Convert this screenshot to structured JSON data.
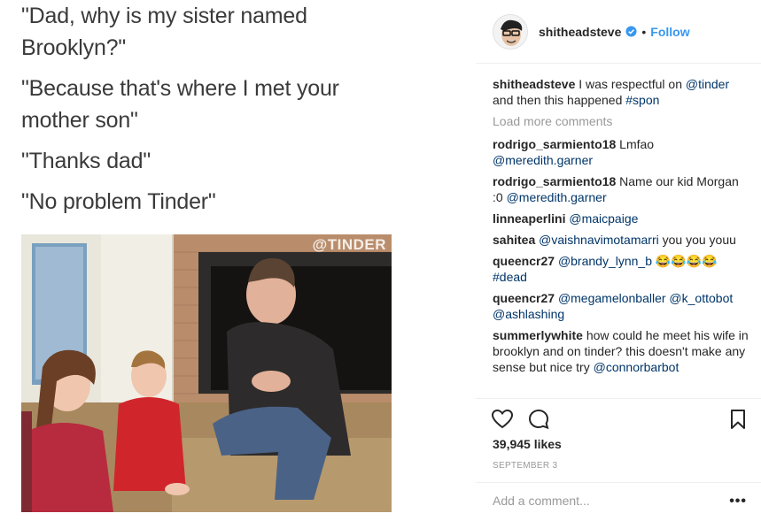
{
  "post": {
    "meme_lines": [
      "\"Dad, why is my sister named Brooklyn?\"",
      "\"Because that's where I met your mother son\"",
      "\"Thanks dad\"",
      "\"No problem Tinder\""
    ],
    "watermark": "@TINDER"
  },
  "header": {
    "author": "shitheadsteve",
    "separator": "•",
    "follow_label": "Follow"
  },
  "caption": {
    "user": "shitheadsteve",
    "text_a": "I was respectful on",
    "mention": "@tinder",
    "text_b": "and then this happened",
    "hashtag": "#spon"
  },
  "load_more": "Load more comments",
  "comments": [
    {
      "user": "rodrigo_sarmiento18",
      "text": "Lmfao",
      "mention": "@meredith.garner"
    },
    {
      "user": "rodrigo_sarmiento18",
      "text": "Name our kid Morgan :0",
      "mention": "@meredith.garner"
    },
    {
      "user": "linneaperlini",
      "text": "",
      "mention": "@maicpaige"
    },
    {
      "user": "sahitea",
      "text": "you you youu",
      "mention": "@vaishnavimotamarri"
    },
    {
      "user": "queencr27",
      "text": "😂😂😂😂",
      "mention": "@brandy_lynn_b",
      "tag": "#dead"
    },
    {
      "user": "queencr27",
      "text": "",
      "mention": "@megamelonballer @k_ottobot @ashlashing"
    },
    {
      "user": "summerlywhite",
      "text": "how could he meet his wife in brooklyn and on tinder? this doesn't make any sense but nice try",
      "mention": "@connorbarbot"
    }
  ],
  "stats": {
    "likes": "39,945 likes",
    "date": "SEPTEMBER 3"
  },
  "add_comment": {
    "placeholder": "Add a comment...",
    "more_label": "•••"
  },
  "icons": {
    "like": "heart-icon",
    "comment": "comment-bubble-icon",
    "save": "bookmark-icon",
    "verified": "verified-badge-icon"
  },
  "colors": {
    "link_blue": "#3897f0",
    "mention_blue": "#003569",
    "muted": "#999999",
    "text": "#262626"
  }
}
